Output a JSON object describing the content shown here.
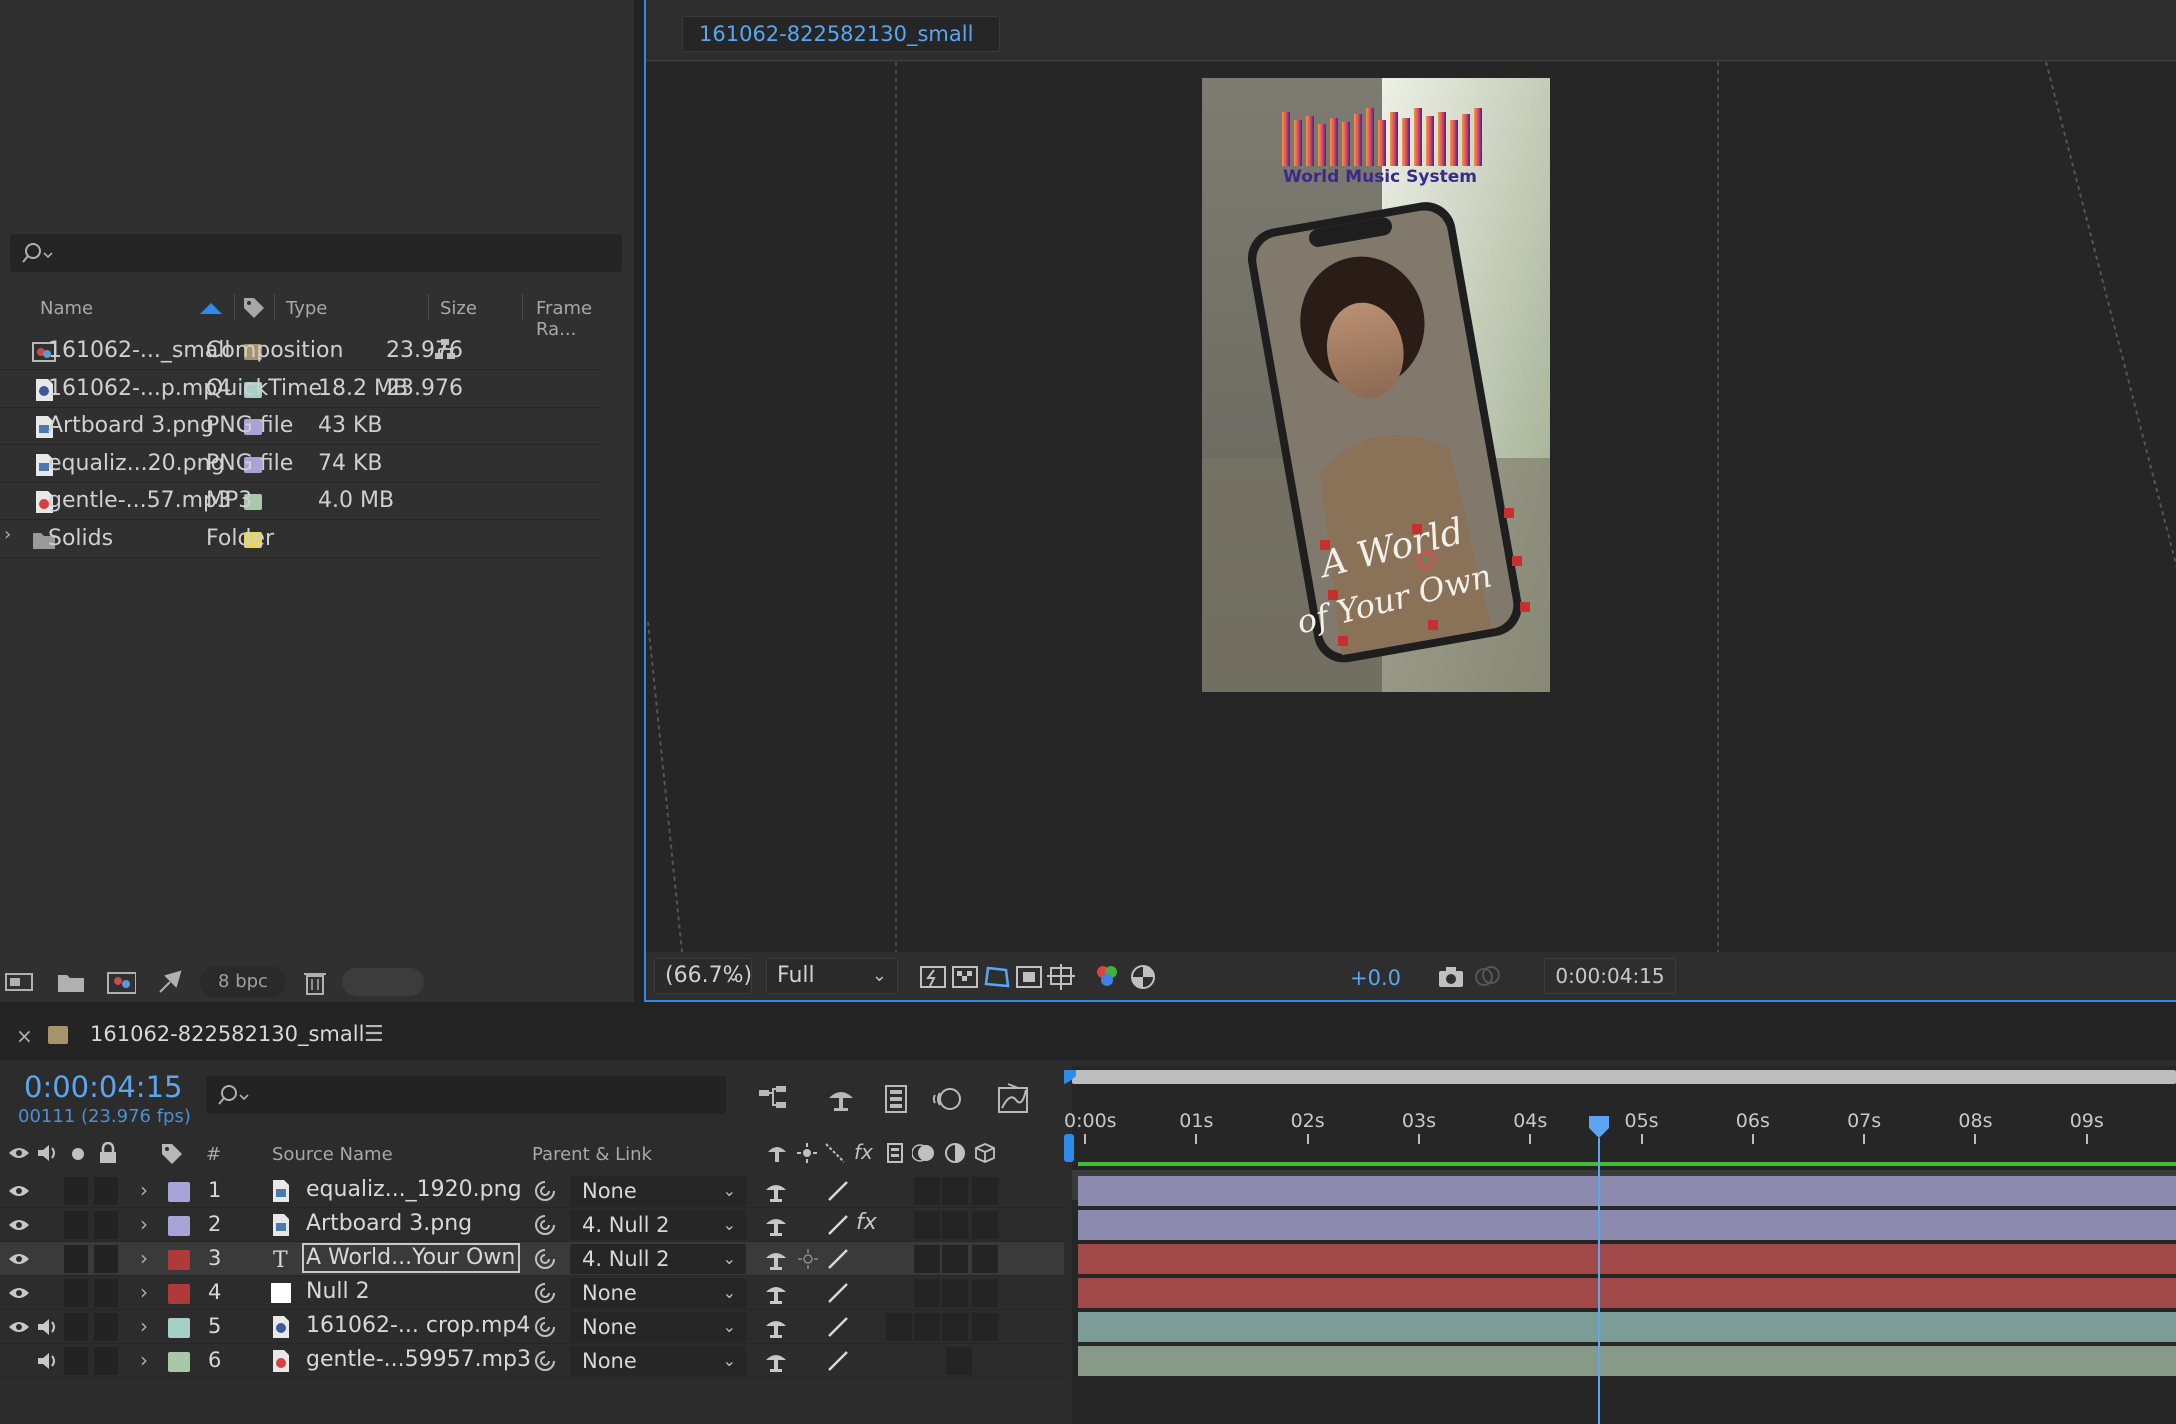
{
  "project": {
    "search_placeholder": "",
    "columns": {
      "name": "Name",
      "type": "Type",
      "size": "Size",
      "frame_rate": "Frame Ra..."
    },
    "items": [
      {
        "name": "161062-..._small",
        "type": "Composition",
        "size": "",
        "frame_rate": "23.976",
        "label_color": "#a8946a",
        "icon": "composition-icon"
      },
      {
        "name": "161062-...p.mp4",
        "type": "QuickTime",
        "size": "18.2 MB",
        "frame_rate": "23.976",
        "label_color": "#a6cfc8",
        "icon": "video-file-icon"
      },
      {
        "name": "Artboard 3.png",
        "type": "PNG file",
        "size": "43 KB",
        "frame_rate": "",
        "label_color": "#a8a4d6",
        "icon": "image-file-icon"
      },
      {
        "name": "equaliz...20.png",
        "type": "PNG file",
        "size": "74 KB",
        "frame_rate": "",
        "label_color": "#a8a4d6",
        "icon": "image-file-icon"
      },
      {
        "name": "gentle-...57.mp3",
        "type": "MP3",
        "size": "4.0 MB",
        "frame_rate": "",
        "label_color": "#a8c8a8",
        "icon": "audio-file-icon"
      },
      {
        "name": "Solids",
        "type": "Folder",
        "size": "",
        "frame_rate": "",
        "label_color": "#e8d84e",
        "icon": "folder-icon"
      }
    ],
    "bpc": "8 bpc"
  },
  "viewer": {
    "tab": "161062-822582130_small",
    "zoom": "(66.7%)",
    "resolution": "Full",
    "exposure": "+0.0",
    "time": "0:00:04:15",
    "artwork": {
      "brand": "World Music System",
      "script_line1": "A World",
      "script_line2": "of Your Own"
    }
  },
  "timeline": {
    "comp_name": "161062-822582130_small",
    "current_time": "0:00:04:15",
    "frame_info": "00111 (23.976 fps)",
    "header": {
      "num": "#",
      "source_name": "Source Name",
      "parent_link": "Parent & Link"
    },
    "ruler_labels": [
      "0:00s",
      "01s",
      "02s",
      "03s",
      "04s",
      "05s",
      "06s",
      "07s",
      "08s",
      "09s"
    ],
    "playhead_seconds": 4.625,
    "layers": [
      {
        "num": "1",
        "name": "equaliz..._1920.png",
        "parent": "None",
        "label_color": "#a8a4d6",
        "icon": "image-layer-icon",
        "bar_color": "#8d8aaf"
      },
      {
        "num": "2",
        "name": "Artboard 3.png",
        "parent": "4. Null 2",
        "label_color": "#a8a4d6",
        "icon": "image-layer-icon",
        "bar_color": "#8d8aaf"
      },
      {
        "num": "3",
        "name": "A World...Your Own",
        "parent": "4. Null 2",
        "label_color": "#b03a3a",
        "icon": "text-layer-icon",
        "bar_color": "#a14848"
      },
      {
        "num": "4",
        "name": "Null 2",
        "parent": "None",
        "label_color": "#b03a3a",
        "icon": "null-layer-icon",
        "bar_color": "#a14848"
      },
      {
        "num": "5",
        "name": "161062-... crop.mp4",
        "parent": "None",
        "label_color": "#a6cfc8",
        "icon": "video-layer-icon",
        "bar_color": "#7c9c97"
      },
      {
        "num": "6",
        "name": "gentle-...59957.mp3",
        "parent": "None",
        "label_color": "#a8c8a8",
        "icon": "audio-layer-icon",
        "bar_color": "#879a87"
      }
    ]
  },
  "colors": {
    "accent": "#2d8ceb",
    "time_blue": "#5aa6f2",
    "work_area_green": "#46b83a"
  }
}
